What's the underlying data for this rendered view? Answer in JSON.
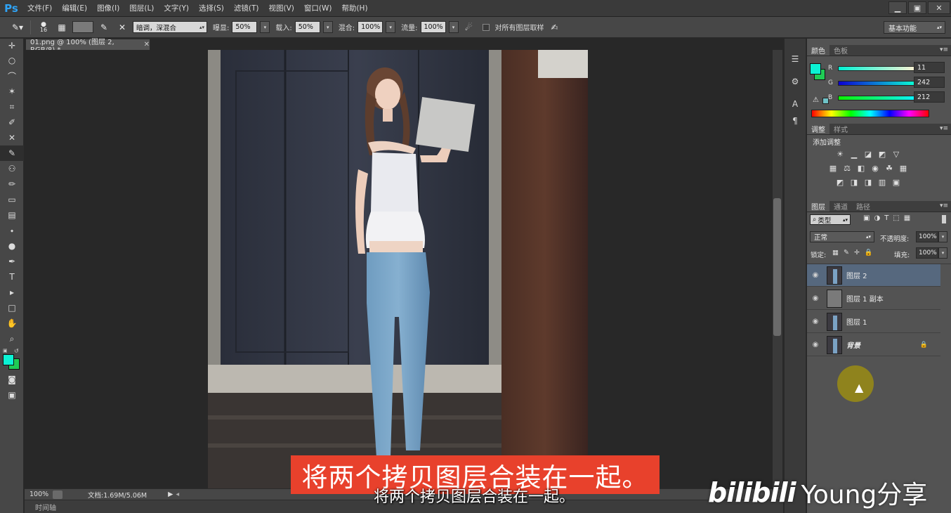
{
  "app": {
    "logo": "Ps"
  },
  "menu": [
    "文件(F)",
    "编辑(E)",
    "图像(I)",
    "图层(L)",
    "文字(Y)",
    "选择(S)",
    "滤镜(T)",
    "视图(V)",
    "窗口(W)",
    "帮助(H)"
  ],
  "window_controls": {
    "minimize": "▁",
    "restore": "▣",
    "close": "✕"
  },
  "options": {
    "brush_size": "16",
    "range_select": "暗调，深混合",
    "exposure_label": "曝显:",
    "exposure_value": "50%",
    "strength_label": "载入:",
    "strength_value": "50%",
    "mix_label": "混合:",
    "mix_value": "100%",
    "flow_label": "流量:",
    "flow_value": "100%",
    "sample_all_label": "对所有图层取样",
    "workspace": "基本功能"
  },
  "document": {
    "tab_title": "01.png @ 100% (图层 2, RGB/8) *",
    "zoom": "100%",
    "doc_size": "文档:1.69M/5.06M",
    "timeline": "时间轴"
  },
  "color_panel": {
    "tabs": [
      "颜色",
      "色板"
    ],
    "r_label": "R",
    "r_value": "11",
    "g_label": "G",
    "g_value": "242",
    "b_label": "B",
    "b_value": "212",
    "foreground": "#0bf2d4",
    "background": "#1fcc55"
  },
  "adjust_panel": {
    "tabs": [
      "调整",
      "样式"
    ],
    "title": "添加调整"
  },
  "layers_panel": {
    "tabs": [
      "图层",
      "通道",
      "路径"
    ],
    "filter": "类型",
    "blend_mode": "正常",
    "opacity_label": "不透明度:",
    "opacity_value": "100%",
    "lock_label": "锁定:",
    "fill_label": "填充:",
    "fill_value": "100%",
    "layers": [
      {
        "name": "图层 2"
      },
      {
        "name": "图层 1 副本"
      },
      {
        "name": "图层 1"
      },
      {
        "name": "背景"
      }
    ]
  },
  "subtitles": {
    "red": "将两个拷贝图层合装在一起。",
    "white": "将两个拷贝图层合装在一起。"
  },
  "watermark": {
    "logo": "bilibili",
    "text": "Young分享"
  }
}
